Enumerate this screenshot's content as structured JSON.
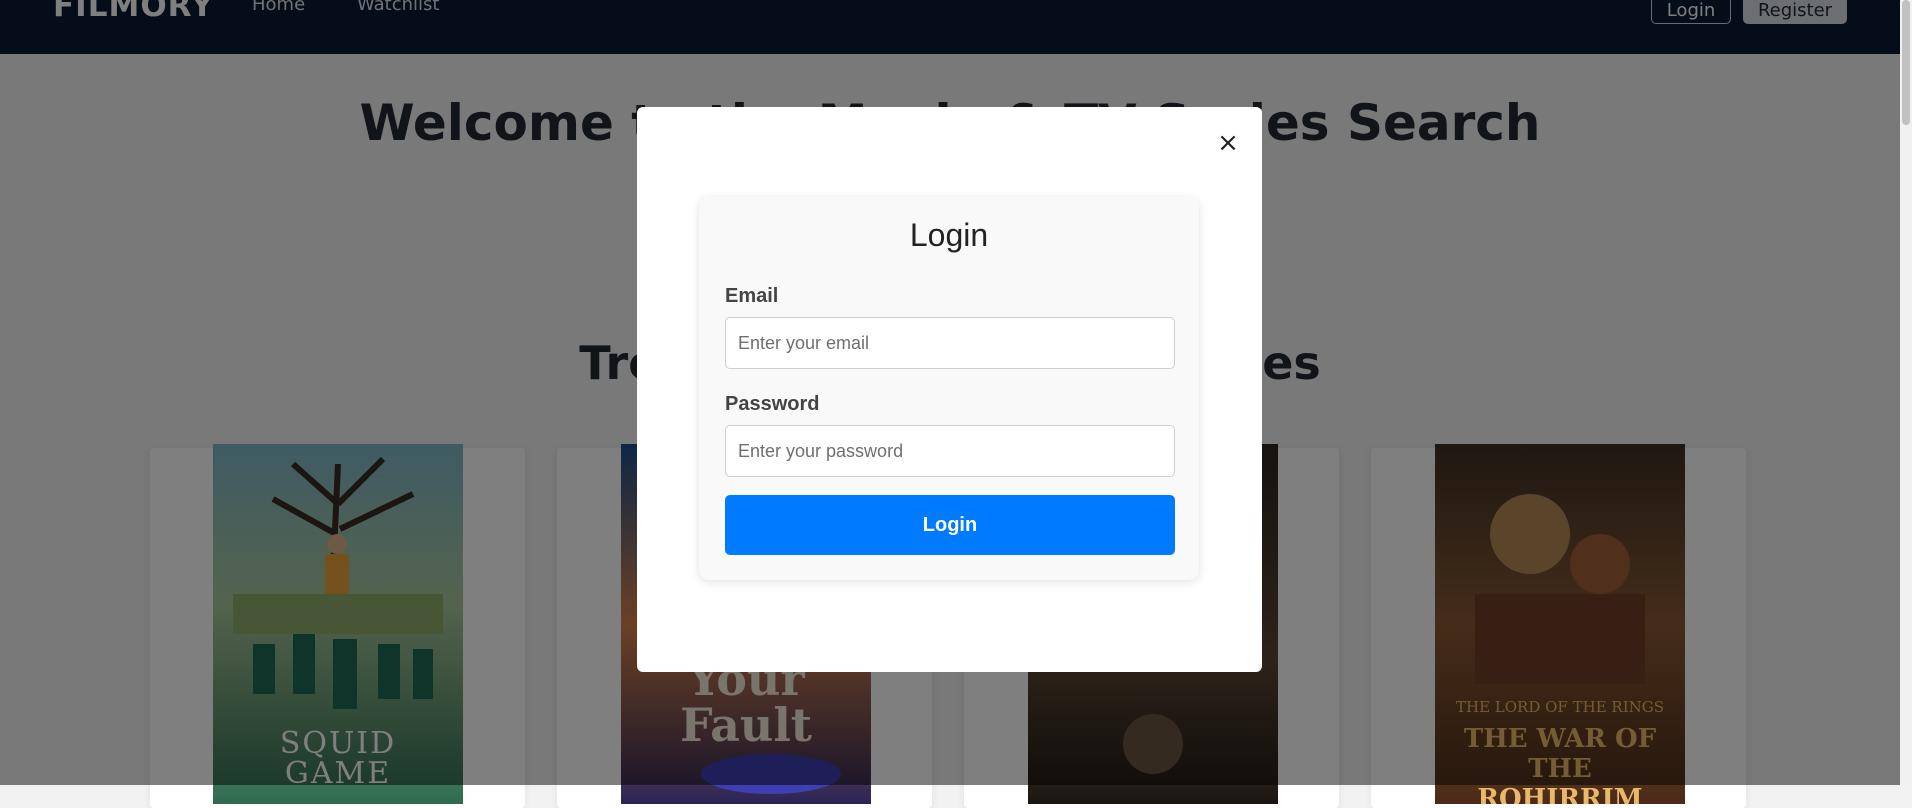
{
  "navbar": {
    "brand": "FILMORY",
    "links": [
      "Home",
      "Watchlist"
    ],
    "login_label": "Login",
    "register_label": "Register"
  },
  "page": {
    "hero_title": "Welcome to the Movie & TV Series Search",
    "section_title": "Trending Movies & TV Series"
  },
  "posters": [
    {
      "title_line1": "SQUID",
      "title_line2": "GAME"
    },
    {
      "title_line1": "Your",
      "title_line2": "Fault"
    },
    {
      "title_line1": "",
      "title_line2": ""
    },
    {
      "title_line1": "THE LORD OF THE RINGS",
      "title_line2": "THE WAR OF THE ROHIRRIM"
    }
  ],
  "modal": {
    "close_symbol": "×",
    "heading": "Login",
    "email_label": "Email",
    "email_placeholder": "Enter your email",
    "password_label": "Password",
    "password_placeholder": "Enter your password",
    "submit_label": "Login"
  },
  "colors": {
    "navbar_bg": "#0b1a33",
    "primary_button": "#007bff",
    "overlay": "rgba(0,0,0,0.5)"
  }
}
